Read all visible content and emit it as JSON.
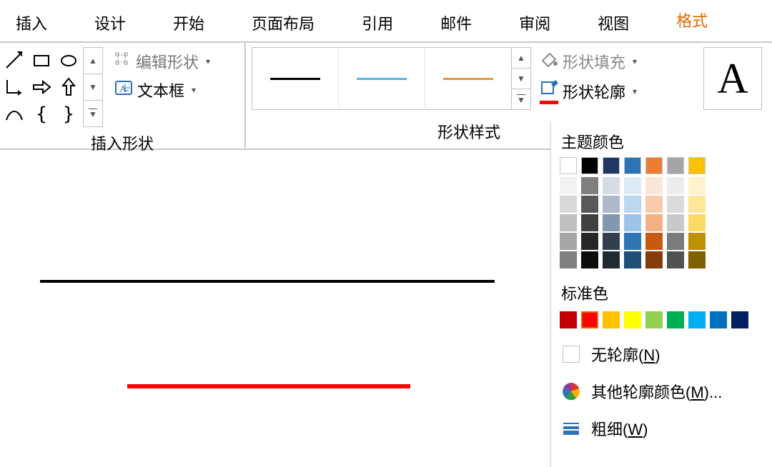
{
  "tabs": {
    "insert": "插入",
    "design": "设计",
    "home": "开始",
    "layout": "页面布局",
    "references": "引用",
    "mail": "邮件",
    "review": "审阅",
    "view": "视图",
    "format": "格式"
  },
  "groups": {
    "insert_shapes_label": "插入形状",
    "shape_styles_label": "形状样式"
  },
  "editshape": {
    "label": "编辑形状"
  },
  "textbox": {
    "label": "文本框"
  },
  "shapefill": {
    "label": "形状填充"
  },
  "shapeoutline": {
    "label": "形状轮廓"
  },
  "style_gallery": {
    "colors": [
      "#000000",
      "#5ab4e4",
      "#e29a3b"
    ]
  },
  "dropdown": {
    "theme_label": "主题颜色",
    "standard_label": "标准色",
    "no_outline_pre": "无轮廓(",
    "no_outline_key": "N",
    "no_outline_post": ")",
    "more_colors_pre": "其他轮廓颜色(",
    "more_colors_key": "M",
    "more_colors_post": ")...",
    "weight_pre": "粗细(",
    "weight_key": "W",
    "weight_post": ")",
    "theme_main": [
      "#ffffff",
      "#000000",
      "#1f3864",
      "#2e74b5",
      "#ed7d31",
      "#a5a5a5",
      "#ffc000"
    ],
    "theme_tints": [
      [
        "#f2f2f2",
        "#d9d9d9",
        "#bfbfbf",
        "#a6a6a6",
        "#7f7f7f"
      ],
      [
        "#7f7f7f",
        "#595959",
        "#404040",
        "#262626",
        "#0d0d0d"
      ],
      [
        "#d6dce5",
        "#adb9ca",
        "#8497b0",
        "#323f4f",
        "#222a35"
      ],
      [
        "#deebf7",
        "#bdd7ee",
        "#9dc3e6",
        "#2e75b6",
        "#1f4e79"
      ],
      [
        "#fbe5d6",
        "#f8cbad",
        "#f4b183",
        "#c55a11",
        "#843c0c"
      ],
      [
        "#ededed",
        "#dbdbdb",
        "#c9c9c9",
        "#7b7b7b",
        "#525252"
      ],
      [
        "#fff2cc",
        "#ffe699",
        "#ffd966",
        "#bf9000",
        "#806000"
      ]
    ],
    "standard": [
      "#c00000",
      "#ff0000",
      "#ffc000",
      "#ffff00",
      "#92d050",
      "#00b050",
      "#00b0f0",
      "#0070c0",
      "#002060"
    ],
    "selected_standard_index": 1
  },
  "canvas": {
    "blackline_color": "#000000",
    "redline_color": "#ff0000"
  },
  "wordart_sample": "A"
}
